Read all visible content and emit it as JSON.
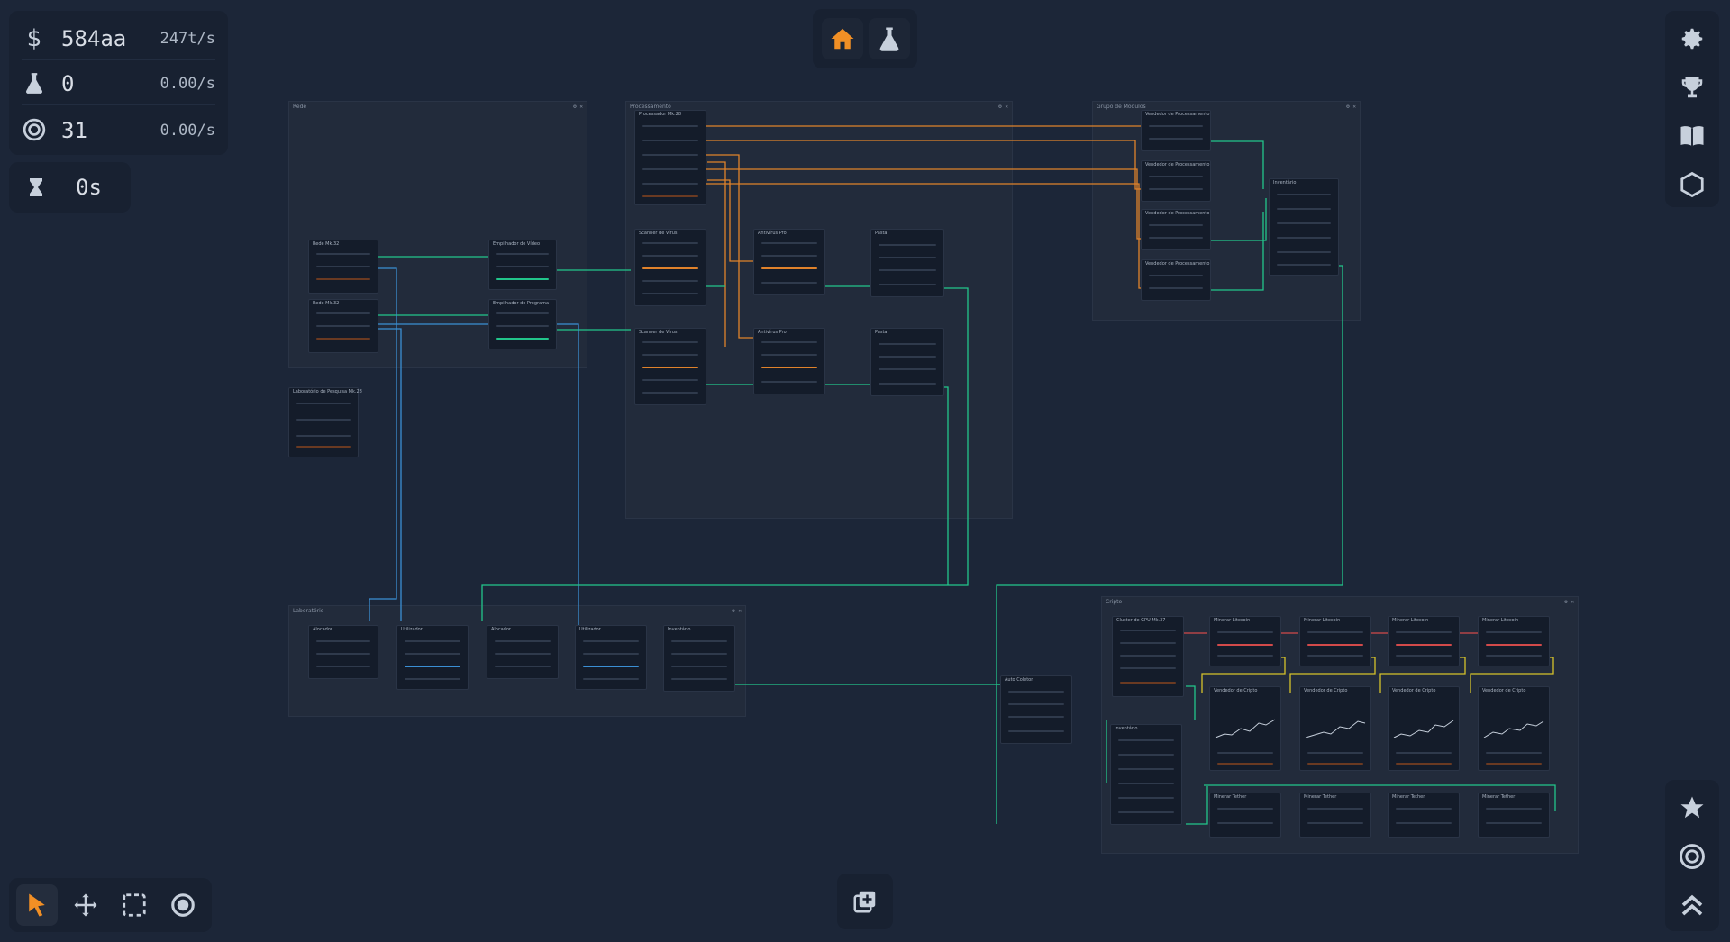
{
  "stats": {
    "money": {
      "icon": "dollar-icon",
      "value": "584aa",
      "rate": "247t/s"
    },
    "research": {
      "icon": "flask-icon",
      "value": "0",
      "rate": "0.00/s"
    },
    "tokens": {
      "icon": "target-coin-icon",
      "value": "31",
      "rate": "0.00/s"
    },
    "timer": {
      "icon": "hourglass-icon",
      "value": "0s"
    }
  },
  "top_nav": {
    "items": [
      "home-icon",
      "flask-icon"
    ],
    "active": "home-icon"
  },
  "right_toolbar": {
    "items": [
      "gear-icon",
      "trophy-icon",
      "book-icon",
      "hexagon-icon"
    ]
  },
  "right_bottom_toolbar": {
    "items": [
      "star-icon",
      "target-coin-icon",
      "chevrons-up-icon"
    ]
  },
  "bottom_tools": {
    "items": [
      "pointer-icon",
      "move-icon",
      "select-box-icon",
      "circle-icon"
    ],
    "active": "pointer-icon"
  },
  "bottom_center": {
    "icon": "add-node-icon"
  },
  "containers": {
    "rede": {
      "title": "Rede"
    },
    "processamento": {
      "title": "Processamento"
    },
    "grupo": {
      "title": "Grupo de Módulos"
    },
    "laboratorio": {
      "title": "Laboratório"
    },
    "cripto": {
      "title": "Cripto"
    }
  },
  "nodes": {
    "rede_a": "Rede Mk.32",
    "rede_b": "Rede Mk.32",
    "video": "Empilhador de Vídeo",
    "prog": "Empilhador de Programa",
    "small": "Laboratório de Pesquisa Mk.28",
    "proc_mk": "Processador Mk.28",
    "scan_a": "Scanner de Vírus",
    "scan_b": "Scanner de Vírus",
    "anti_a": "Antivírus Pro",
    "anti_b": "Antivírus Pro",
    "pasta_a": "Pasta",
    "pasta_b": "Pasta",
    "vend1": "Vendedor de Processamento",
    "vend2": "Vendedor de Processamento",
    "vend3": "Vendedor de Processamento",
    "vend4": "Vendedor de Processamento",
    "inv_grupo": "Inventário",
    "aloc": "Alocador",
    "util1": "Utilizador",
    "aloc2": "Alocador",
    "util2": "Utilizador",
    "inv_lab": "Inventário",
    "auto": "Auto Coletor",
    "cluster": "Cluster de GPU Mk.37",
    "min1": "Minerar Litecoin",
    "min2": "Minerar Litecoin",
    "min3": "Minerar Litecoin",
    "min4": "Minerar Litecoin",
    "cv1": "Vendedor de Cripto",
    "cv2": "Vendedor de Cripto",
    "cv3": "Vendedor de Cripto",
    "cv4": "Vendedor de Cripto",
    "inv_cripto": "Inventário",
    "tet1": "Minerar Tether",
    "tet2": "Minerar Tether",
    "tet3": "Minerar Tether",
    "tet4": "Minerar Tether"
  },
  "colors": {
    "accent": "#f18f25",
    "wire_green": "#22c58b",
    "wire_orange": "#e0822b",
    "wire_blue": "#3b8fd4",
    "wire_yellow": "#d6c22a",
    "wire_red": "#d24a4a"
  }
}
